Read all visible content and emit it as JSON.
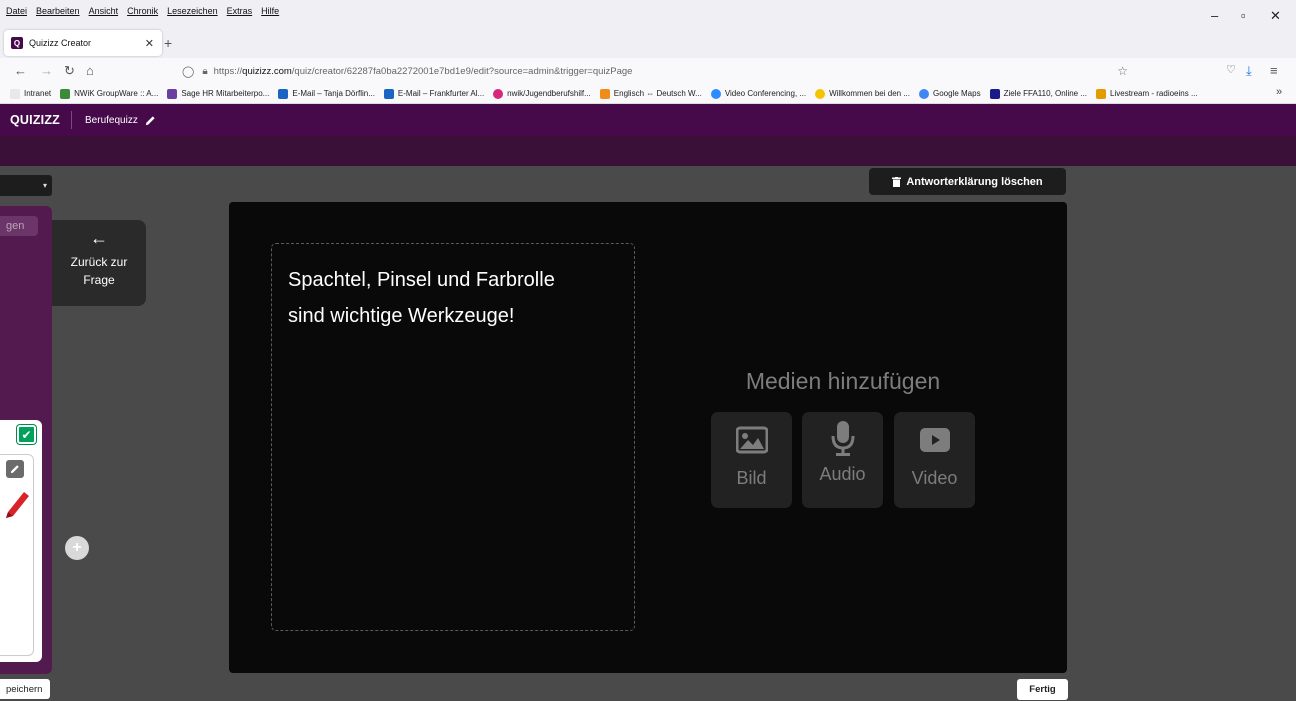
{
  "browser": {
    "menu": [
      "Datei",
      "Bearbeiten",
      "Ansicht",
      "Chronik",
      "Lesezeichen",
      "Extras",
      "Hilfe"
    ],
    "tab_title": "Quizizz Creator",
    "url_prefix": "https://",
    "url_domain": "quizizz.com",
    "url_path": "/quiz/creator/62287fa0ba2272001e7bd1e9/edit?source=admin&trigger=quizPage",
    "bookmarks": [
      {
        "label": "Intranet",
        "color": "#e8e8e8"
      },
      {
        "label": "NWiK GroupWare :: A...",
        "color": "#3a8a3a"
      },
      {
        "label": "Sage HR Mitarbeiterpo...",
        "color": "#6b3fa0"
      },
      {
        "label": "E-Mail – Tanja Dörflin...",
        "color": "#1b64c2"
      },
      {
        "label": "E-Mail – Frankfurter Al...",
        "color": "#1b64c2"
      },
      {
        "label": "nwik/Jugendberufshilf...",
        "color": "#d6287a"
      },
      {
        "label": "Englisch ⇔ Deutsch W...",
        "color": "#f08c1a"
      },
      {
        "label": "Video Conferencing, ...",
        "color": "#2d8cff"
      },
      {
        "label": "Willkommen bei den ...",
        "color": "#f5c400"
      },
      {
        "label": "Google Maps",
        "color": "#4285f4"
      },
      {
        "label": "Ziele FFA110, Online ...",
        "color": "#1a1a8a"
      },
      {
        "label": "Livestream - radioeins ...",
        "color": "#e39b00"
      }
    ]
  },
  "app": {
    "logo": "QUIZIZZ",
    "quiz_name": "Berufequizz"
  },
  "left_panel": {
    "partial_pill": "gen",
    "save_label": "peichern"
  },
  "back_button": {
    "label": "Zurück zur Frage"
  },
  "delete_button": {
    "label": "Antworterklärung löschen"
  },
  "editor": {
    "explanation_text": "Spachtel, Pinsel und Farbrolle sind wichtige Werkzeuge!",
    "media_title": "Medien hinzufügen",
    "media_buttons": [
      "Bild",
      "Audio",
      "Video"
    ]
  },
  "footer": {
    "done_label": "Fertig"
  },
  "colors": {
    "brand": "#460a4b",
    "editor_bg": "#090909",
    "page_bg": "#4a4a4a"
  }
}
